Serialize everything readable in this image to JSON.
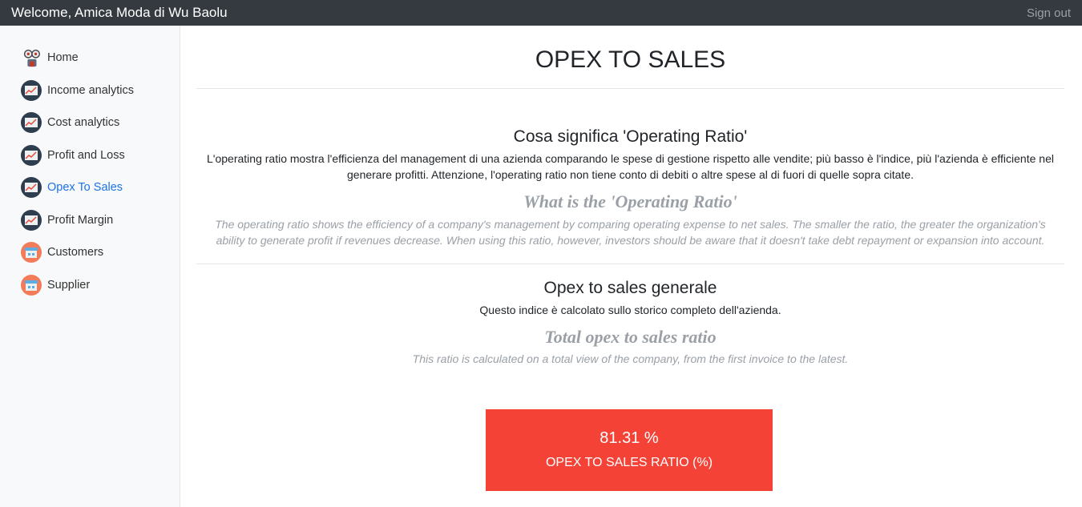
{
  "header": {
    "welcome": "Welcome, Amica Moda di Wu Baolu",
    "signout": "Sign out"
  },
  "sidebar": {
    "items": [
      {
        "label": "Home",
        "icon": "home-icon"
      },
      {
        "label": "Income analytics",
        "icon": "chart-icon"
      },
      {
        "label": "Cost analytics",
        "icon": "chart-icon"
      },
      {
        "label": "Profit and Loss",
        "icon": "chart-icon"
      },
      {
        "label": "Opex To Sales",
        "icon": "chart-icon",
        "active": true
      },
      {
        "label": "Profit Margin",
        "icon": "chart-icon"
      },
      {
        "label": "Customers",
        "icon": "shop-icon"
      },
      {
        "label": "Supplier",
        "icon": "shop-icon"
      }
    ]
  },
  "main": {
    "title": "OPEX TO SALES",
    "definition": {
      "title_it": "Cosa significa 'Operating Ratio'",
      "body_it": "L'operating ratio mostra l'efficienza del management di una azienda comparando le spese di gestione rispetto alle vendite; più basso è l'indice, più l'azienda è efficiente nel generare profitti. Attenzione, l'operating ratio non tiene conto di debiti o altre spese al di fuori di quelle sopra citate.",
      "title_en": "What is the 'Operating Ratio'",
      "body_en": "The operating ratio shows the efficiency of a company's management by comparing operating expense to net sales. The smaller the ratio, the greater the organization's ability to generate profit if revenues decrease. When using this ratio, however, investors should be aware that it doesn't take debt repayment or expansion into account."
    },
    "general": {
      "title_it": "Opex to sales generale",
      "body_it": "Questo indice è calcolato sullo storico completo dell'azienda.",
      "title_en": "Total opex to sales ratio",
      "body_en": "This ratio is calculated on a total view of the company, from the first invoice to the latest."
    },
    "card": {
      "value": "81.31 %",
      "label": "OPEX TO SALES RATIO (%)",
      "color": "#f44236"
    }
  },
  "colors": {
    "topbar": "#343a40",
    "sidebar": "#f8f9fa",
    "active_link": "#1a73e8",
    "muted_text": "#9aa0a6"
  }
}
